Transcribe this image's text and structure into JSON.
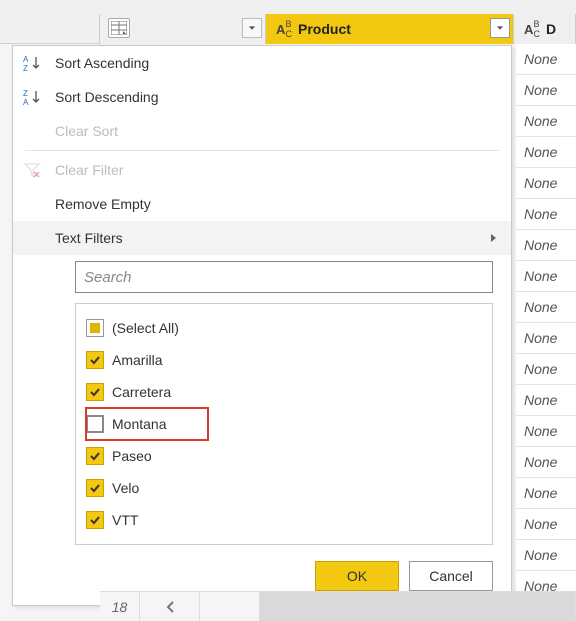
{
  "header": {
    "columns": [
      {
        "name": "blank",
        "label": ""
      },
      {
        "name": "product",
        "label": "Product",
        "type": "ABC",
        "active": true
      },
      {
        "name": "d",
        "label": "D",
        "type": "ABC"
      }
    ]
  },
  "data_column_values": [
    "None",
    "None",
    "None",
    "None",
    "None",
    "None",
    "None",
    "None",
    "None",
    "None",
    "None",
    "None",
    "None",
    "None",
    "None",
    "None",
    "None",
    "None"
  ],
  "menu": {
    "sort_asc": "Sort Ascending",
    "sort_desc": "Sort Descending",
    "clear_sort": "Clear Sort",
    "clear_filter": "Clear Filter",
    "remove_empty": "Remove Empty",
    "text_filters": "Text Filters"
  },
  "search": {
    "placeholder": "Search"
  },
  "filter_values": [
    {
      "label": "(Select All)",
      "state": "mixed",
      "highlight": false
    },
    {
      "label": "Amarilla",
      "state": "checked",
      "highlight": false
    },
    {
      "label": "Carretera",
      "state": "checked",
      "highlight": false
    },
    {
      "label": "Montana",
      "state": "empty",
      "highlight": true
    },
    {
      "label": "Paseo",
      "state": "checked",
      "highlight": false
    },
    {
      "label": "Velo",
      "state": "checked",
      "highlight": false
    },
    {
      "label": "VTT",
      "state": "checked",
      "highlight": false
    }
  ],
  "buttons": {
    "ok": "OK",
    "cancel": "Cancel"
  },
  "footer_row_number": "18"
}
